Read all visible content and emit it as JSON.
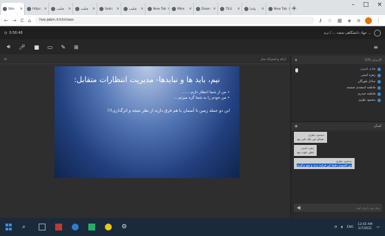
{
  "browser": {
    "tabs": [
      {
        "label": "Site"
      },
      {
        "label": "https:"
      },
      {
        "label": "فیلیپ"
      },
      {
        "label": "فیلیپ"
      },
      {
        "label": "Sakri"
      },
      {
        "label": "فیلیپ"
      },
      {
        "label": "New Tab"
      },
      {
        "label": "Mike"
      },
      {
        "label": "Down"
      },
      {
        "label": "TELI"
      },
      {
        "label": "واسا"
      },
      {
        "label": "New Tab"
      }
    ],
    "url": "live.jabm.ir/ch/class"
  },
  "app": {
    "time": "0:56:48",
    "title": "جهاد دانشگاهی شعبه ... / ترم ..."
  },
  "presentation": {
    "header_title": "ارائه و اشتراک ساز",
    "slide_title": "نیم، باید ها و نبایدها- مدیریت انتظارات متقابل:",
    "bullets": [
      "من از شما انتظار دارم........",
      "من خودم را به شما گره میزنم...."
    ],
    "body": "این دو جمله زمین تا آسمان با هم فرق دارند از نظر نتیجه و اثرگذاری!!!"
  },
  "users": {
    "header": "کاربران (15)",
    "list": [
      {
        "name": "هادی امیری",
        "highlight": true
      },
      {
        "name": "زهره امینی",
        "highlight": false
      },
      {
        "name": "ساناز بلورگان",
        "highlight": false
      },
      {
        "name": "فاطمه اسفندی چشمه",
        "highlight": false
      },
      {
        "name": "فاطمه حیدری",
        "highlight": false
      },
      {
        "name": "محمود نظری",
        "highlight": false
      }
    ]
  },
  "chat": {
    "header": "گفتگو",
    "messages": [
      {
        "who": "محمود نظری",
        "text": "صدای من چک بانی بود"
      },
      {
        "who": "زهره امینی",
        "text": "خیلی خوب بود"
      },
      {
        "who": "محمود نظری",
        "text": "من کمبودم دقیقا این فرایند ردید و نفع برگیری",
        "highlight": true
      }
    ],
    "placeholder": "پیام خود را وارد کنید"
  },
  "taskbar": {
    "time": "12:45 AM",
    "date": "1/7/2021",
    "lang": "ENG"
  }
}
